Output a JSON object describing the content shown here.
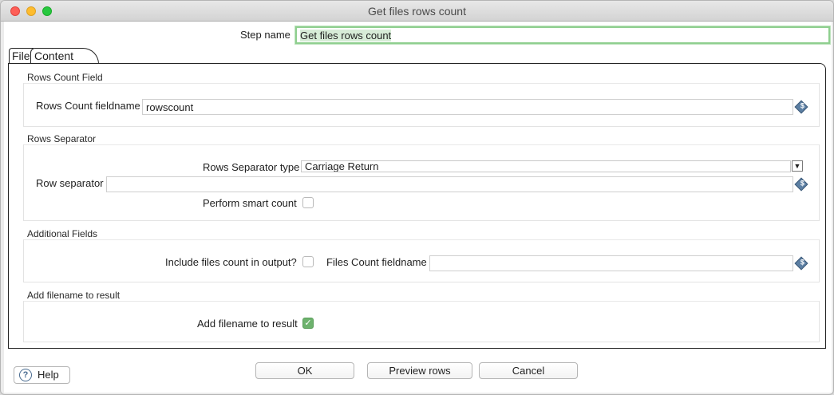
{
  "window": {
    "title": "Get files rows count"
  },
  "step": {
    "label": "Step name",
    "value": "Get files rows count"
  },
  "tabs": [
    {
      "label": "File"
    },
    {
      "label": "Content"
    }
  ],
  "groups": {
    "rows_count_field": {
      "title": "Rows Count Field",
      "fieldname_label": "Rows Count fieldname",
      "fieldname_value": "rowscount"
    },
    "rows_separator": {
      "title": "Rows Separator",
      "type_label": "Rows Separator type",
      "type_value": "Carriage Return",
      "row_separator_label": "Row separator",
      "row_separator_value": "",
      "smart_count_label": "Perform smart count",
      "smart_count_checked": false
    },
    "additional_fields": {
      "title": "Additional Fields",
      "include_files_count_label": "Include files count in output?",
      "include_files_count_checked": false,
      "files_count_fieldname_label": "Files Count fieldname",
      "files_count_fieldname_value": ""
    },
    "add_filename": {
      "title": "Add filename to result",
      "add_filename_label": "Add filename to result",
      "add_filename_checked": true
    }
  },
  "buttons": {
    "help": "Help",
    "ok": "OK",
    "preview": "Preview rows",
    "cancel": "Cancel"
  },
  "icons": {
    "variable": "variable-icon",
    "help": "help-icon",
    "dropdown": "chevron-down-icon",
    "check": "checkmark-icon"
  },
  "colors": {
    "step_name_highlight": "#8fcf8f",
    "checkbox_checked": "#6db26d",
    "variable_icon": "#5c7fa3"
  }
}
